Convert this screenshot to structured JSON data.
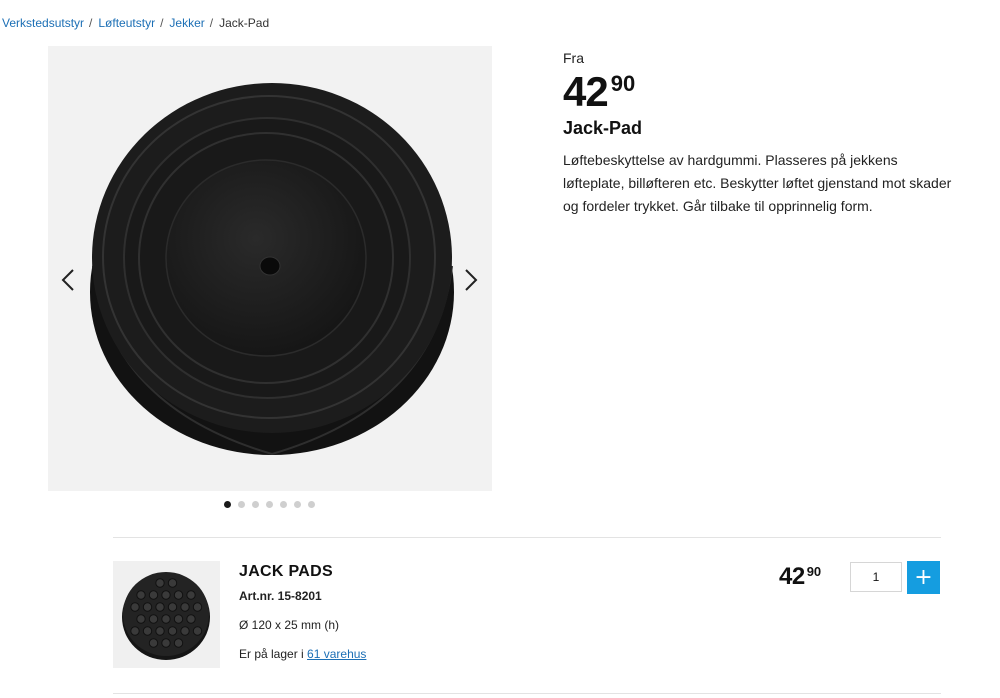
{
  "breadcrumb": [
    {
      "label": "Verkstedsutstyr"
    },
    {
      "label": "Løfteutstyr"
    },
    {
      "label": "Jekker"
    }
  ],
  "breadcrumb_current": "Jack-Pad",
  "breadcrumb_separator": "/",
  "gallery": {
    "prev_icon": "chevron-left-icon",
    "next_icon": "chevron-right-icon",
    "dot_count": 7,
    "active_index": 0
  },
  "product": {
    "from_label": "Fra",
    "price_kr": "42",
    "price_ore": "90",
    "title": "Jack-Pad",
    "description": "Løftebeskyttelse av hardgummi. Plasseres på jekkens løfteplate, billøfteren etc. Beskytter løftet gjenstand mot skader og fordeler trykket. Går tilbake til opprinnelig form."
  },
  "variant": {
    "name": "JACK PADS",
    "art_nr": "Art.nr. 15-8201",
    "size": "Ø 120 x 25 mm (h)",
    "stock_prefix": "Er på lager i",
    "stock_link": "61 varehus",
    "price_kr": "42",
    "price_ore": "90",
    "quantity": "1",
    "add_label": "+"
  },
  "colors": {
    "link": "#1c6fb5",
    "add_button": "#159de0",
    "rubber": "#1c1c1c"
  }
}
